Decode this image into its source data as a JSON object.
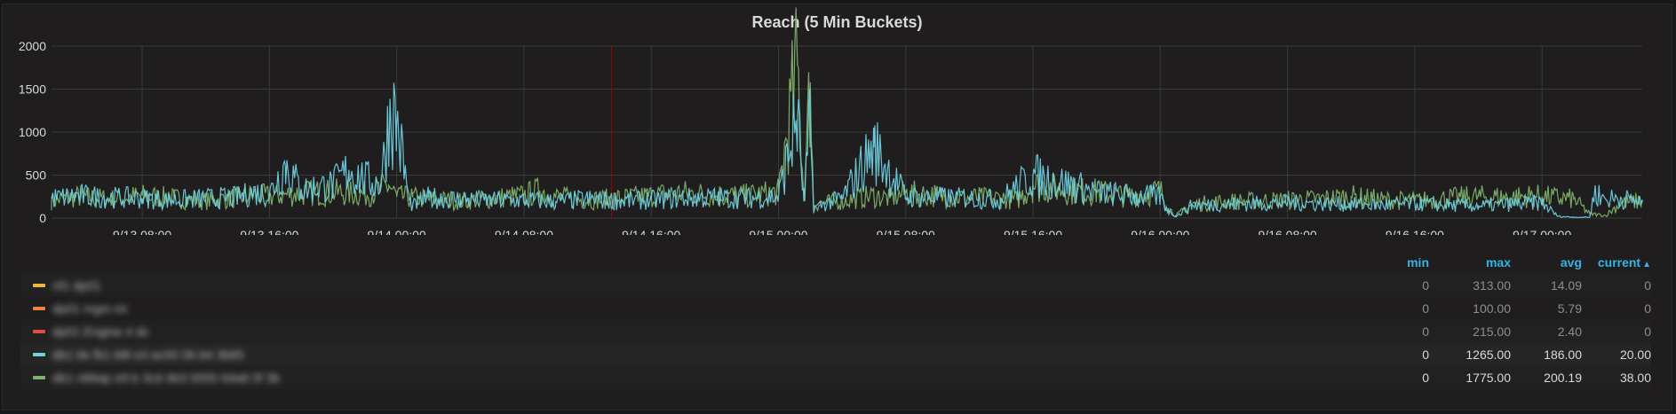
{
  "panel": {
    "title": "Reach (5 Min Buckets)"
  },
  "legend": {
    "headers": {
      "min": "min",
      "max": "max",
      "avg": "avg",
      "current": "current",
      "sort_icon": "▲"
    },
    "rows": [
      {
        "name": "nf1 dp01",
        "color": "#f2b43d",
        "min": "0",
        "max": "313.00",
        "avg": "14.09",
        "current": "0",
        "bright": false
      },
      {
        "name": "dp01 mgm ini",
        "color": "#ef843c",
        "min": "0",
        "max": "100.00",
        "avg": "5.79",
        "current": "0",
        "bright": false
      },
      {
        "name": "dp01 Engine 4 dc",
        "color": "#e24d42",
        "min": "0",
        "max": "215.00",
        "avg": "2.40",
        "current": "0",
        "bright": false
      },
      {
        "name": "db1 bk fb1 bl8 e3 ac00 06 b4 3b65",
        "color": "#6ed0e0",
        "min": "0",
        "max": "1265.00",
        "avg": "186.00",
        "current": "20.00",
        "bright": true
      },
      {
        "name": "db1 n86ap e9 b 3cd 4b3 0000 64a8 0f 3b",
        "color": "#7eb26d",
        "min": "0",
        "max": "1775.00",
        "avg": "200.19",
        "current": "38.00",
        "bright": true
      }
    ]
  },
  "chart_data": {
    "type": "line",
    "title": "Reach (5 Min Buckets)",
    "xlabel": "",
    "ylabel": "",
    "ylim": [
      0,
      2000
    ],
    "y_ticks": [
      "0",
      "500",
      "1000",
      "1500",
      "2000"
    ],
    "x_ticks": [
      "9/13 08:00",
      "9/13 16:00",
      "9/14 00:00",
      "9/14 08:00",
      "9/14 16:00",
      "9/15 00:00",
      "9/15 08:00",
      "9/15 16:00",
      "9/16 00:00",
      "9/16 08:00",
      "9/16 16:00",
      "9/17 00:00"
    ],
    "x_tick_hours": [
      8,
      16,
      24,
      32,
      40,
      48,
      56,
      64,
      72,
      80,
      88,
      96
    ],
    "x_range_hours": [
      2.3,
      102.3
    ],
    "grid": true,
    "annotation_hour": 37.5,
    "annotation_color": "#a00000",
    "series": [
      {
        "color": "#7eb26d",
        "x": [
          2.3,
          4,
          6,
          8,
          10,
          12,
          14,
          15,
          16,
          18,
          20,
          22,
          23,
          23.5,
          24,
          25,
          26,
          28,
          30,
          32,
          33,
          34,
          36,
          38,
          40,
          41,
          42,
          44,
          46,
          48,
          49.2,
          49.6,
          50,
          50.2,
          52,
          54,
          55,
          56,
          58,
          60,
          62,
          63,
          64,
          66,
          68,
          70,
          71,
          72,
          72.5,
          73,
          74,
          76,
          78,
          80,
          82,
          84,
          86,
          88,
          90,
          92,
          94,
          95.5,
          96,
          98,
          99,
          100,
          101,
          102.3
        ],
        "y": [
          200,
          250,
          220,
          260,
          230,
          200,
          240,
          270,
          250,
          290,
          300,
          280,
          330,
          380,
          250,
          240,
          220,
          200,
          230,
          260,
          320,
          250,
          210,
          230,
          260,
          280,
          290,
          270,
          260,
          300,
          1775,
          200,
          1580,
          160,
          200,
          260,
          230,
          290,
          260,
          240,
          230,
          210,
          380,
          330,
          300,
          260,
          280,
          320,
          120,
          30,
          160,
          190,
          200,
          210,
          220,
          250,
          210,
          200,
          230,
          250,
          240,
          260,
          250,
          220,
          50,
          30,
          180,
          200
        ]
      },
      {
        "color": "#6ed0e0",
        "x": [
          2.3,
          4,
          6,
          8,
          10,
          12,
          14,
          15,
          16,
          17,
          18,
          20,
          21,
          22,
          23,
          23.6,
          24,
          24.8,
          25,
          26,
          28,
          30,
          32,
          34,
          36,
          38,
          40,
          42,
          44,
          46,
          48,
          49.2,
          49.6,
          50,
          50.2,
          52,
          54,
          56,
          58,
          60,
          62,
          64,
          66,
          68,
          70,
          72,
          72.5,
          73,
          74,
          76,
          78,
          80,
          82,
          84,
          86,
          88,
          90,
          92,
          94,
          96,
          97,
          98,
          99,
          99.3,
          100,
          101,
          102.3
        ],
        "y": [
          230,
          260,
          240,
          230,
          210,
          230,
          240,
          300,
          280,
          620,
          330,
          380,
          560,
          440,
          400,
          1265,
          1100,
          200,
          140,
          240,
          220,
          200,
          210,
          190,
          220,
          200,
          210,
          230,
          240,
          230,
          250,
          1180,
          200,
          1100,
          120,
          230,
          820,
          250,
          240,
          230,
          220,
          500,
          400,
          300,
          260,
          250,
          80,
          20,
          150,
          160,
          170,
          180,
          170,
          160,
          150,
          170,
          150,
          140,
          160,
          180,
          20,
          10,
          10,
          300,
          220,
          230,
          180
        ]
      }
    ]
  }
}
